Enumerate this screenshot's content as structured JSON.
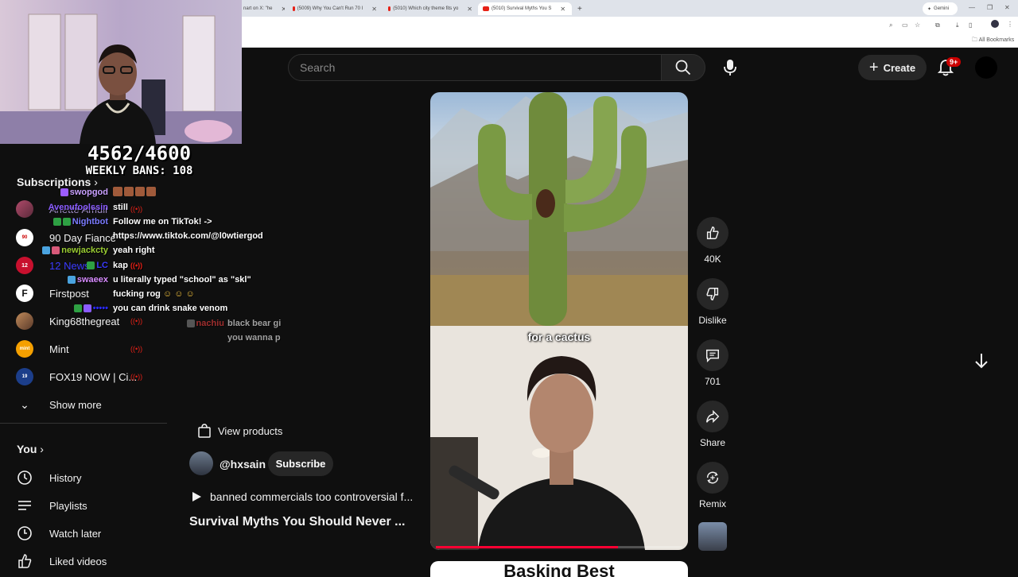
{
  "browser": {
    "tabs": [
      {
        "title": "nart on X: \"he"
      },
      {
        "title": "(5009) Why You Can't Run 70 I"
      },
      {
        "title": "(5010) Which city theme fits yo"
      },
      {
        "title": "(5010) Survival Myths You S"
      }
    ],
    "gemini_label": "Gemini",
    "bookmarks_label": "All Bookmarks"
  },
  "overlay": {
    "counter": "4562/4600",
    "weekly_bans": "WEEKLY BANS: 108"
  },
  "header": {
    "search_placeholder": "Search",
    "create_label": "Create",
    "notifications_badge": "9+"
  },
  "sidebar": {
    "subscriptions_title": "Subscriptions",
    "subscriptions": [
      {
        "name": "Arlette Amuli"
      },
      {
        "name": "90 Day Fiancé"
      },
      {
        "name": "12 News"
      },
      {
        "name": "Firstpost"
      },
      {
        "name": "King68thegreat"
      },
      {
        "name": "Mint"
      },
      {
        "name": "FOX19 NOW | Ci..."
      }
    ],
    "show_more": "Show more",
    "you_title": "You",
    "you_items": [
      {
        "label": "History"
      },
      {
        "label": "Playlists"
      },
      {
        "label": "Watch later"
      },
      {
        "label": "Liked videos"
      }
    ]
  },
  "chat": [
    {
      "user": "swopgod",
      "message": "",
      "color": "#c9a0ff"
    },
    {
      "user": "Avenufoolssin",
      "message": "still",
      "color": "#8a5cff"
    },
    {
      "user": "Nightbot",
      "message": "Follow me on TikTok! ->",
      "color": "#7b7bff"
    },
    {
      "user": "",
      "message": "https://www.tiktok.com/@l0wtiergod",
      "color": "#ffffff"
    },
    {
      "user": "newjackcty",
      "message": "yeah right",
      "color": "#9acd32"
    },
    {
      "user": "",
      "message": "kap",
      "color": "#2a2aff"
    },
    {
      "user": "swaeex",
      "message": "u literally typed \"school\" as \"skl\"",
      "color": "#d88cff"
    },
    {
      "user": "",
      "message": "fucking rog",
      "color": "#ffffff"
    },
    {
      "user": "",
      "message": "you can drink snake venom",
      "color": "#2a2aff"
    },
    {
      "user": "nachiu",
      "message": "black bear gi",
      "color": "#ff4444"
    },
    {
      "user": "",
      "message": "you wanna p",
      "color": "#ffffff"
    }
  ],
  "video": {
    "caption": "for a cactus",
    "next_short_text": "Basking Best",
    "progress": 0.74
  },
  "actions": {
    "like_count": "40K",
    "dislike_label": "Dislike",
    "comment_count": "701",
    "share_label": "Share",
    "remix_label": "Remix"
  },
  "meta": {
    "view_products": "View products",
    "channel_handle": "@hxsain",
    "subscribe_label": "Subscribe",
    "related_title": "banned commercials too controversial f...",
    "video_title": "Survival Myths You Should Never ..."
  },
  "colors": {
    "background": "#0f0f0f",
    "accent": "#ff0033",
    "live": "#e62117",
    "button_bg": "#272727"
  }
}
